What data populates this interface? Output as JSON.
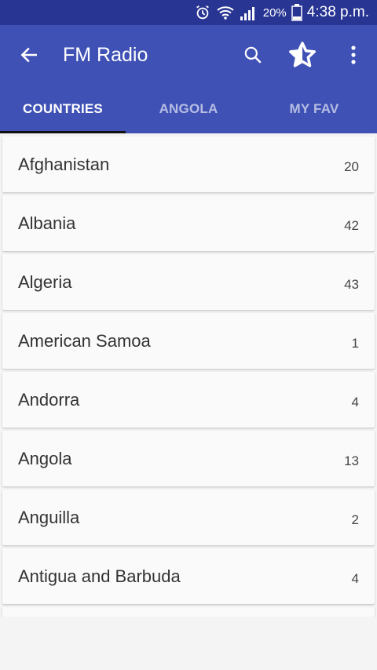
{
  "status": {
    "battery_percent": "20%",
    "time": "4:38 p.m."
  },
  "appbar": {
    "title": "FM Radio",
    "icons": [
      "back-arrow-icon",
      "search-icon",
      "star-icon",
      "more-vert-icon"
    ]
  },
  "tabs": [
    {
      "label": "COUNTRIES",
      "active": true
    },
    {
      "label": "ANGOLA",
      "active": false
    },
    {
      "label": "MY FAV",
      "active": false
    }
  ],
  "countries": [
    {
      "name": "Afghanistan",
      "count": "20"
    },
    {
      "name": "Albania",
      "count": "42"
    },
    {
      "name": "Algeria",
      "count": "43"
    },
    {
      "name": "American Samoa",
      "count": "1"
    },
    {
      "name": "Andorra",
      "count": "4"
    },
    {
      "name": "Angola",
      "count": "13"
    },
    {
      "name": "Anguilla",
      "count": "2"
    },
    {
      "name": "Antigua and Barbuda",
      "count": "4"
    }
  ],
  "colors": {
    "primary": "#3f51b5",
    "primary_dark": "#283593",
    "indicator": "#111111"
  }
}
